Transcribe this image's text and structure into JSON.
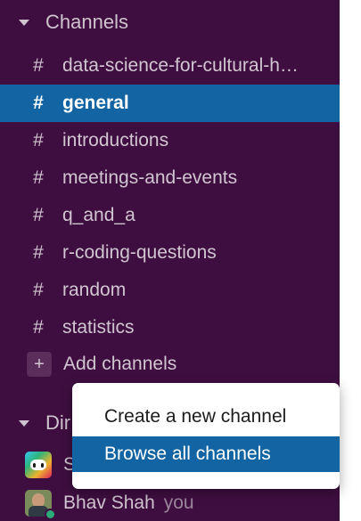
{
  "channels_section": {
    "title": "Channels"
  },
  "channels": [
    {
      "name": "data-science-for-cultural-h…"
    },
    {
      "name": "general",
      "active": true
    },
    {
      "name": "introductions"
    },
    {
      "name": "meetings-and-events"
    },
    {
      "name": "q_and_a"
    },
    {
      "name": "r-coding-questions"
    },
    {
      "name": "random"
    },
    {
      "name": "statistics"
    }
  ],
  "channel_prefix": "#",
  "add_channels": {
    "icon": "plus-icon",
    "label": "Add channels"
  },
  "dm_section": {
    "title": "Dir"
  },
  "direct_messages": [
    {
      "name": "S",
      "avatar": "slackbot-avatar"
    },
    {
      "name": "Bhav Shah",
      "suffix": "you",
      "avatar": "user-photo-avatar",
      "status": "online"
    }
  ],
  "context_menu": {
    "items": [
      {
        "label": "Create a new channel"
      },
      {
        "label": "Browse all channels",
        "highlighted": true
      }
    ]
  },
  "colors": {
    "sidebar_bg": "#3f0e40",
    "active_bg": "#1264a3",
    "text": "#d1c5d1",
    "presence_online": "#2bac76"
  }
}
